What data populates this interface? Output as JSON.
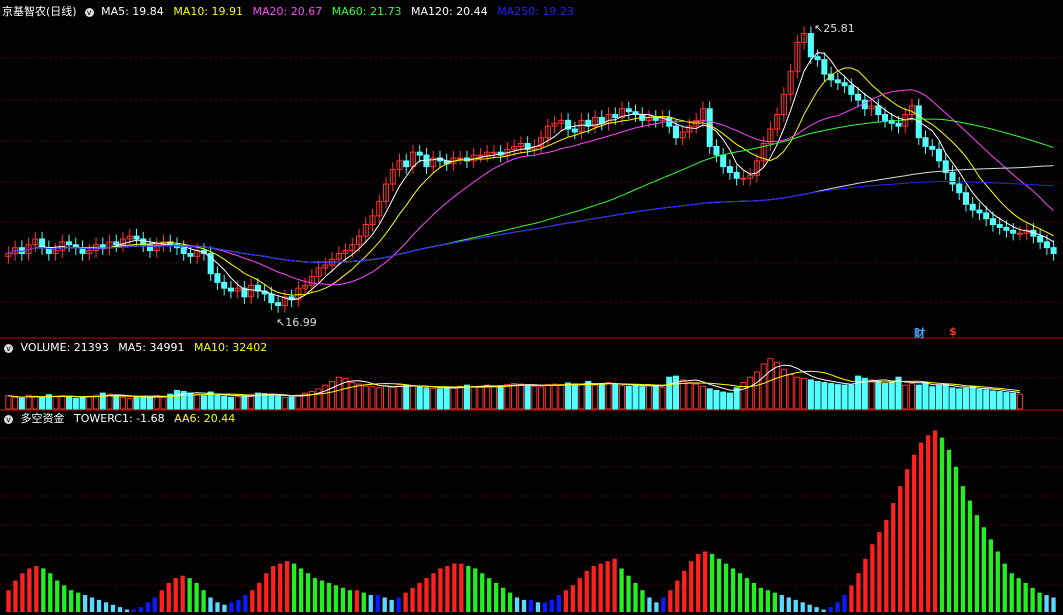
{
  "panel1": {
    "title": "京基智农(日线)",
    "ma": [
      {
        "label": "MA5: 19.84",
        "color": "#ffffff"
      },
      {
        "label": "MA10: 19.91",
        "color": "#ffff00"
      },
      {
        "label": "MA20: 20.67",
        "color": "#ff44ff"
      },
      {
        "label": "MA60: 21.73",
        "color": "#33ff33"
      },
      {
        "label": "MA120: 20.44",
        "color": "#ffffff"
      },
      {
        "label": "MA250: 19.23",
        "color": "#2222ff"
      }
    ],
    "high_label": "25.81",
    "low_label": "16.99",
    "tag_cai": "财",
    "tag_s": "$"
  },
  "panel2": {
    "items": [
      {
        "label": "VOLUME: 21393",
        "color": "#ffffff"
      },
      {
        "label": "MA5: 34991",
        "color": "#ffffff"
      },
      {
        "label": "MA10: 32402",
        "color": "#ffff00"
      }
    ]
  },
  "panel3": {
    "items": [
      {
        "label": "多空资金",
        "color": "#ffffff"
      },
      {
        "label": "TOWERC1: -1.68",
        "color": "#ffffff"
      },
      {
        "label": "AA6: 20.44",
        "color": "#ffff00"
      }
    ]
  },
  "chart_data": {
    "type": "candlestick",
    "close": [
      19.0,
      19.2,
      19.0,
      19.3,
      19.5,
      19.2,
      19.0,
      19.1,
      19.4,
      19.3,
      19.2,
      19.0,
      19.1,
      19.3,
      19.2,
      19.4,
      19.3,
      19.5,
      19.6,
      19.5,
      19.3,
      19.1,
      19.3,
      19.4,
      19.3,
      19.2,
      19.0,
      18.9,
      19.1,
      19.0,
      18.3,
      18.0,
      17.8,
      17.7,
      17.8,
      17.5,
      17.9,
      17.7,
      17.6,
      17.3,
      17.2,
      17.5,
      17.4,
      17.8,
      17.9,
      18.2,
      18.5,
      18.6,
      18.8,
      19.0,
      19.1,
      19.3,
      19.6,
      20.0,
      20.3,
      20.8,
      21.4,
      21.9,
      22.2,
      22.0,
      22.5,
      22.4,
      22.0,
      22.3,
      22.2,
      22.1,
      22.3,
      22.3,
      22.2,
      22.4,
      22.4,
      22.5,
      22.5,
      22.4,
      22.6,
      22.7,
      22.8,
      22.6,
      22.7,
      23.0,
      23.4,
      23.5,
      23.6,
      23.3,
      23.2,
      23.6,
      23.4,
      23.7,
      23.5,
      23.8,
      23.7,
      24.0,
      23.9,
      23.8,
      23.6,
      23.7,
      23.6,
      23.7,
      23.4,
      23.0,
      23.2,
      23.4,
      23.6,
      24.0,
      22.7,
      22.4,
      22.0,
      21.8,
      21.6,
      21.6,
      21.7,
      22.2,
      22.8,
      23.3,
      23.8,
      24.5,
      25.3,
      26.3,
      26.6,
      25.8,
      25.7,
      25.2,
      25.0,
      24.9,
      24.8,
      24.5,
      24.3,
      24.0,
      24.1,
      23.8,
      23.6,
      23.5,
      23.4,
      23.8,
      24.1,
      23.0,
      22.7,
      22.6,
      22.2,
      21.8,
      21.4,
      21.1,
      20.7,
      20.5,
      20.4,
      20.2,
      20.0,
      19.9,
      19.8,
      19.7,
      19.7,
      19.8,
      19.6,
      19.4,
      19.2,
      19.0
    ],
    "volume": [
      25,
      22,
      20,
      26,
      24,
      21,
      27,
      23,
      25,
      24,
      20,
      22,
      24,
      26,
      30,
      28,
      25,
      22,
      20,
      24,
      23,
      21,
      25,
      22,
      28,
      35,
      33,
      30,
      27,
      25,
      32,
      26,
      24,
      22,
      23,
      25,
      27,
      30,
      29,
      28,
      24,
      22,
      23,
      26,
      30,
      33,
      38,
      45,
      52,
      60,
      58,
      50,
      47,
      43,
      42,
      40,
      44,
      41,
      46,
      45,
      43,
      42,
      40,
      39,
      38,
      41,
      40,
      43,
      45,
      42,
      43,
      45,
      42,
      44,
      46,
      48,
      47,
      45,
      43,
      42,
      46,
      47,
      46,
      49,
      47,
      46,
      52,
      45,
      48,
      50,
      46,
      44,
      43,
      46,
      42,
      44,
      45,
      41,
      60,
      62,
      55,
      50,
      47,
      43,
      38,
      35,
      32,
      30,
      40,
      50,
      60,
      70,
      85,
      95,
      88,
      75,
      65,
      60,
      58,
      55,
      52,
      50,
      48,
      46,
      45,
      45,
      62,
      58,
      55,
      52,
      48,
      50,
      60,
      45,
      48,
      45,
      50,
      42,
      44,
      46,
      40,
      38,
      39,
      42,
      37,
      36,
      34,
      33,
      31,
      30,
      28
    ],
    "tower": [
      9,
      13,
      16,
      18,
      19,
      18,
      16,
      13,
      11,
      9,
      8,
      7,
      6,
      5,
      4,
      3,
      2,
      1,
      1,
      2,
      4,
      6,
      9,
      12,
      14,
      15,
      14,
      12,
      9,
      6,
      4,
      3,
      4,
      5,
      7,
      9,
      12,
      16,
      19,
      20,
      21,
      20,
      18,
      16,
      14,
      13,
      12,
      11,
      10,
      9,
      9,
      8,
      7,
      7,
      6,
      5,
      6,
      8,
      10,
      12,
      14,
      16,
      18,
      19,
      20,
      20,
      19,
      18,
      16,
      14,
      12,
      10,
      8,
      6,
      5,
      5,
      4,
      4,
      5,
      7,
      9,
      11,
      14,
      17,
      19,
      20,
      21,
      22,
      18,
      15,
      12,
      9,
      6,
      4,
      6,
      9,
      13,
      17,
      21,
      24,
      25,
      24,
      22,
      20,
      18,
      16,
      14,
      12,
      10,
      9,
      8,
      7,
      6,
      5,
      4,
      3,
      2,
      1,
      2,
      4,
      7,
      11,
      16,
      22,
      28,
      33,
      38,
      45,
      52,
      59,
      65,
      70,
      73,
      75,
      72,
      67,
      60,
      52,
      46,
      40,
      35,
      30,
      25,
      20,
      16,
      14,
      12,
      10,
      8,
      7,
      6
    ],
    "high_value": 25.81,
    "low_value": 16.99
  }
}
